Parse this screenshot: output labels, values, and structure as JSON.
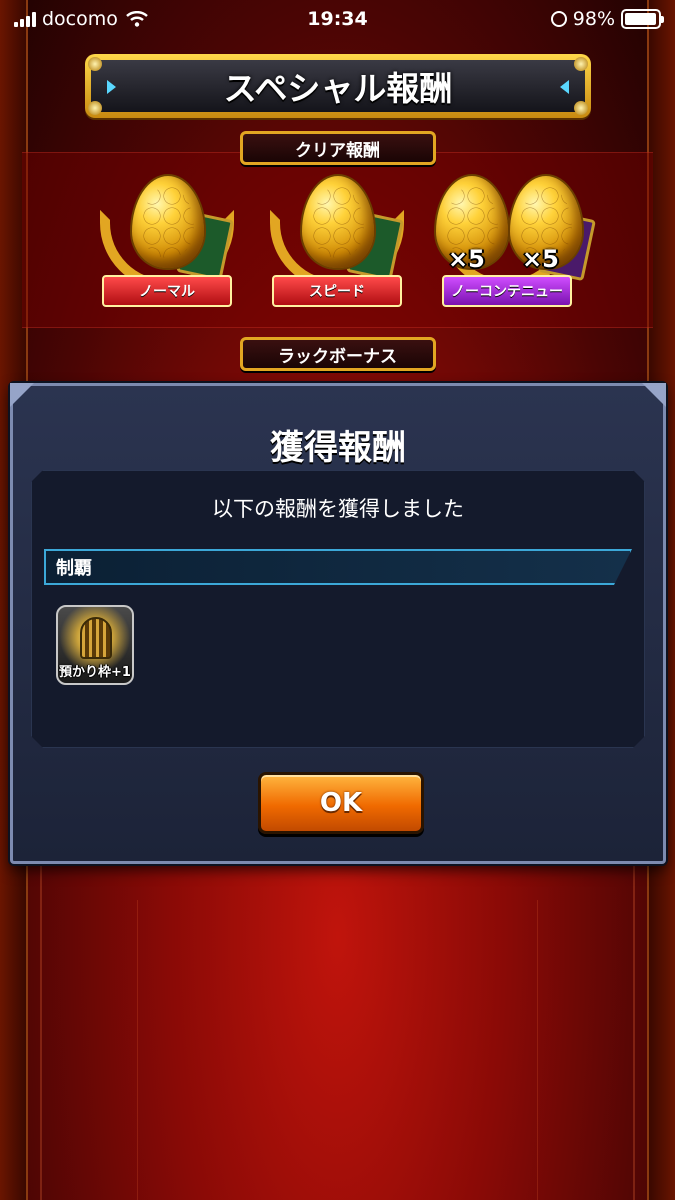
{
  "status_bar": {
    "carrier": "docomo",
    "time": "19:34",
    "battery": "98%",
    "battery_level": 0.98
  },
  "header": {
    "title": "スペシャル報酬"
  },
  "sections": {
    "clear_label": "クリア報酬",
    "luck_label": "ラックボーナス"
  },
  "rewards": [
    {
      "label": "ノーマル",
      "multiplier": ""
    },
    {
      "label": "スピード",
      "multiplier": ""
    },
    {
      "label": "ノーコンテニュー",
      "multiplier_a": "×5",
      "multiplier_b": "×5"
    }
  ],
  "dialog": {
    "title": "獲得報酬",
    "message": "以下の報酬を獲得しました",
    "category": "制覇",
    "item_label": "預かり枠+1",
    "ok_label": "OK"
  },
  "colors": {
    "accent_gold": "#e2a622",
    "dialog_bg": "#2b3450",
    "ok_button": "#f06a00",
    "category_border": "#3ca8d8"
  }
}
